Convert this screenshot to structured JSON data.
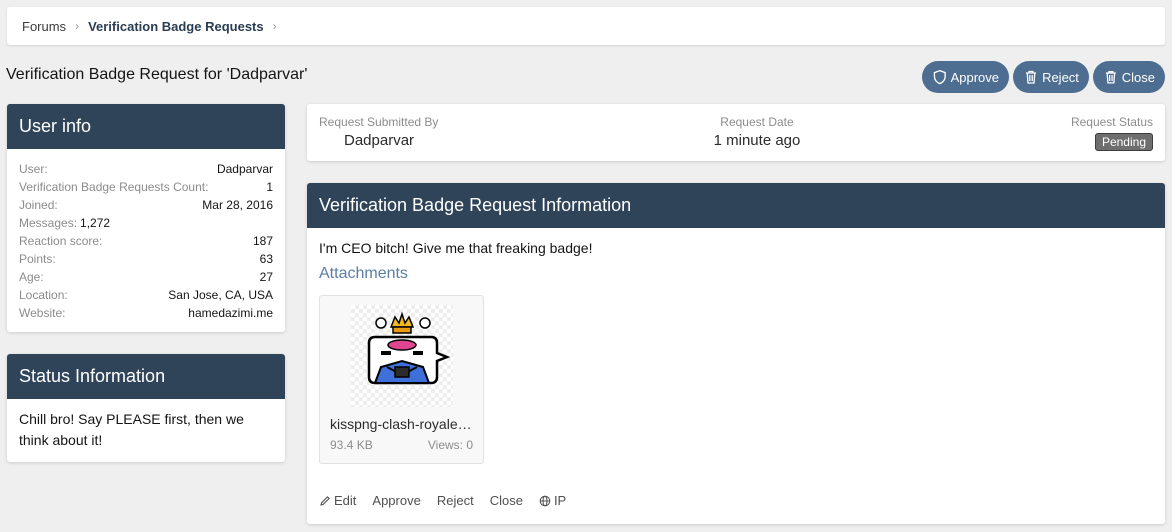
{
  "breadcrumb": {
    "items": [
      "Forums",
      "Verification Badge Requests"
    ]
  },
  "page_title": "Verification Badge Request for 'Dadparvar'",
  "actions": {
    "approve": "Approve",
    "reject": "Reject",
    "close": "Close"
  },
  "user_info": {
    "title": "User info",
    "rows": [
      {
        "label": "User:",
        "value": "Dadparvar"
      },
      {
        "label": "Verification Badge Requests Count:",
        "value": "1"
      },
      {
        "label": "Joined:",
        "value": "Mar 28, 2016"
      },
      {
        "label": "Messages:",
        "value": "1,272"
      },
      {
        "label": "Reaction score:",
        "value": "187"
      },
      {
        "label": "Points:",
        "value": "63"
      },
      {
        "label": "Age:",
        "value": "27"
      },
      {
        "label": "Location:",
        "value": "San Jose, CA, USA"
      },
      {
        "label": "Website:",
        "value": "hamedazimi.me"
      }
    ]
  },
  "status_info": {
    "title": "Status Information",
    "text": "Chill bro! Say PLEASE first, then we think about it!"
  },
  "request_meta": {
    "submitted_by_label": "Request Submitted By",
    "submitted_by": "Dadparvar",
    "date_label": "Request Date",
    "date": "1 minute ago",
    "status_label": "Request Status",
    "status": "Pending"
  },
  "request_info": {
    "title": "Verification Badge Request Information",
    "text": "I'm CEO bitch! Give me that freaking badge!",
    "attachments_label": "Attachments",
    "attachment": {
      "name": "kisspng-clash-royale-clash-of-clans-emoji.png",
      "size": "93.4 KB",
      "views": "Views: 0"
    },
    "footer": {
      "edit": "Edit",
      "approve": "Approve",
      "reject": "Reject",
      "close": "Close",
      "ip": "IP"
    }
  },
  "colors": {
    "header_bg": "#2f4459",
    "button_bg": "#4d6e91",
    "link": "#5b7fa6"
  }
}
